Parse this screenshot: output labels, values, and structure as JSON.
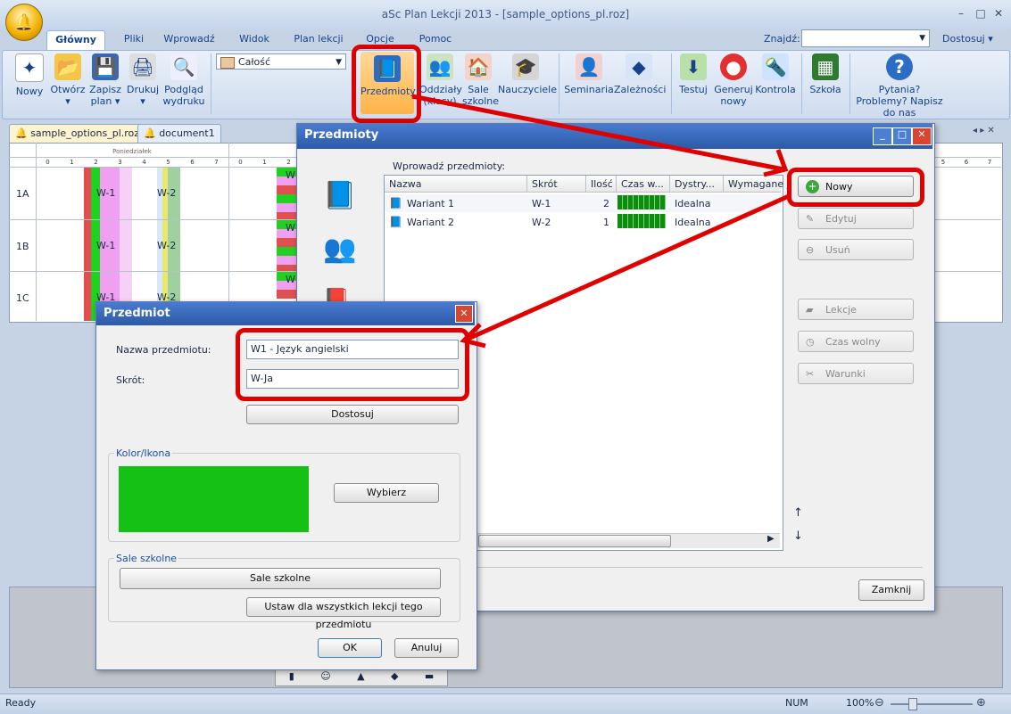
{
  "window": {
    "title": "aSc Plan Lekcji 2013  - [sample_options_pl.roz]"
  },
  "menu": {
    "tabs": [
      "Główny",
      "Pliki",
      "Wprowadź",
      "Widok",
      "Plan lekcji",
      "Opcje",
      "Pomoc"
    ],
    "search_label": "Znajdź:",
    "customize": "Dostosuj"
  },
  "ribbon": {
    "new": "Nowy",
    "open": "Otwórz",
    "save": "Zapisz plan",
    "print": "Drukuj",
    "preview": "Podgląd wydruku",
    "filter": "Całość",
    "subjects": "Przedmioty",
    "classes": "Oddziały (klasy)",
    "rooms": "Sale szkolne",
    "teachers": "Nauczyciele",
    "seminars": "Seminaria",
    "relations": "Zależności",
    "test": "Testuj",
    "generate": "Generuj nowy",
    "control": "Kontrola",
    "school": "Szkoła",
    "help": "Pytania? Problemy? Napisz do nas"
  },
  "doc_tabs": [
    "sample_options_pl.roz",
    "document1"
  ],
  "grid": {
    "day": "Poniedziałek",
    "periods": [
      "0",
      "1",
      "2",
      "3",
      "4",
      "5",
      "6",
      "7"
    ],
    "periods2": [
      "0",
      "1",
      "2"
    ],
    "classes": [
      "1A",
      "1B",
      "1C"
    ],
    "cell_w1": "W-1",
    "cell_w2": "W-2",
    "cell_w": "W"
  },
  "subjects_dialog": {
    "title": "Przedmioty",
    "list_label": "Wprowadź przedmioty:",
    "columns": [
      "Nazwa",
      "Skrót",
      "Ilość",
      "Czas w...",
      "Dystry...",
      "Wymagane j"
    ],
    "rows": [
      {
        "name": "Wariant 1",
        "short": "W-1",
        "count": "2",
        "dist": "Idealna"
      },
      {
        "name": "Wariant 2",
        "short": "W-2",
        "count": "1",
        "dist": "Idealna"
      }
    ],
    "buttons": {
      "new": "Nowy",
      "edit": "Edytuj",
      "delete": "Usuń",
      "lessons": "Lekcje",
      "free_time": "Czas wolny",
      "conditions": "Warunki",
      "close": "Zamknij"
    }
  },
  "subject_dialog": {
    "title": "Przedmiot",
    "name_label": "Nazwa przedmiotu:",
    "name_value": "W1 - Język angielski",
    "short_label": "Skrót:",
    "short_value": "W-Ja",
    "customize_btn": "Dostosuj",
    "color_group": "Kolor/Ikona",
    "color_value": "#14c114",
    "choose_btn": "Wybierz",
    "rooms_group": "Sale szkolne",
    "rooms_btn": "Sale szkolne",
    "apply_all_btn": "Ustaw dla wszystkich lekcji tego przedmiotu",
    "ok": "OK",
    "cancel": "Anuluj"
  },
  "status": {
    "ready": "Ready",
    "num": "NUM",
    "zoom": "100%"
  }
}
